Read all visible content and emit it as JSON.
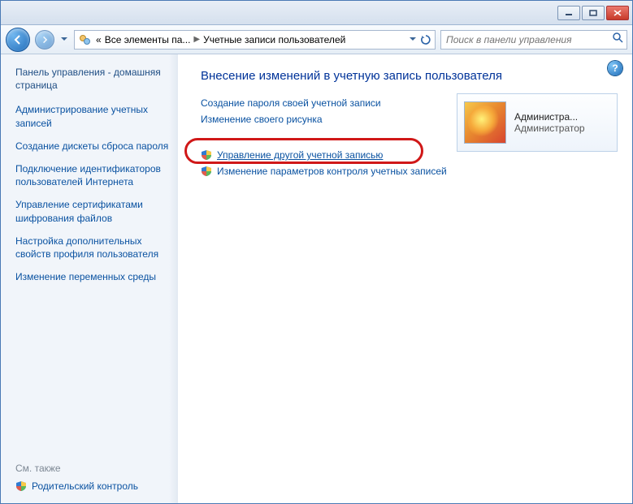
{
  "titlebar": {
    "minimize": "minimize",
    "maximize": "maximize",
    "close": "close"
  },
  "nav": {
    "breadcrumb_prefix": "«",
    "breadcrumb1": "Все элементы па...",
    "breadcrumb2": "Учетные записи пользователей",
    "search_placeholder": "Поиск в панели управления"
  },
  "sidebar": {
    "home": "Панель управления - домашняя страница",
    "links": [
      "Администрирование учетных записей",
      "Создание дискеты сброса пароля",
      "Подключение идентификаторов пользователей Интернета",
      "Управление сертификатами шифрования файлов",
      "Настройка дополнительных свойств профиля пользователя",
      "Изменение переменных среды"
    ],
    "see_also_label": "См. также",
    "parental": "Родительский контроль"
  },
  "main": {
    "heading": "Внесение изменений в учетную запись пользователя",
    "link_create_password": "Создание пароля своей учетной записи",
    "link_change_picture": "Изменение своего рисунка",
    "link_manage_other": "Управление другой учетной записью",
    "link_uac_settings": "Изменение параметров контроля учетных записей"
  },
  "user_card": {
    "name": "Администра...",
    "role": "Администратор"
  }
}
